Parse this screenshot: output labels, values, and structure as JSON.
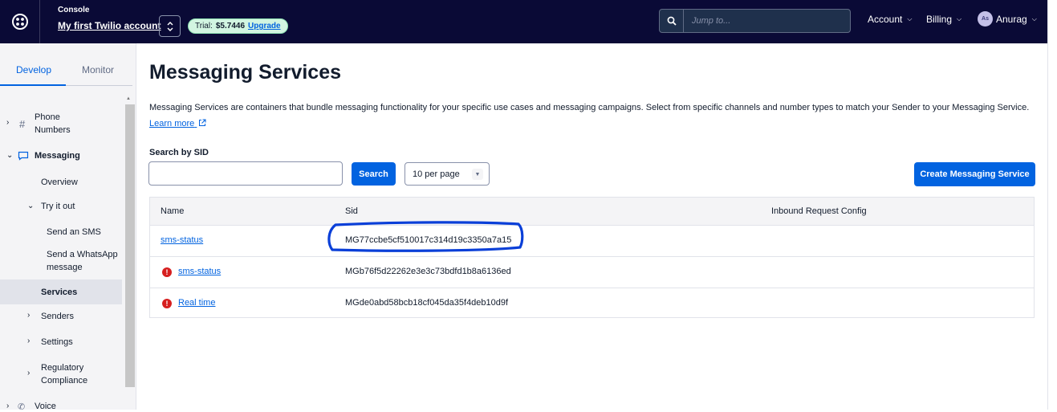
{
  "topbar": {
    "console_label": "Console",
    "account_name": "My first Twilio account",
    "trial_prefix": "Trial:",
    "trial_amount": "$5.7446",
    "upgrade_label": "Upgrade",
    "search_placeholder": "Jump to...",
    "account_menu": "Account",
    "billing_menu": "Billing",
    "user_initials": "As",
    "user_name": "Anurag"
  },
  "sidebar": {
    "tabs": [
      "Develop",
      "Monitor"
    ],
    "active_tab": "Develop",
    "items": {
      "phone_numbers_line1": "Phone",
      "phone_numbers_line2": "Numbers",
      "messaging": "Messaging",
      "overview": "Overview",
      "try_it_out": "Try it out",
      "send_sms": "Send an SMS",
      "send_whatsapp_line1": "Send a WhatsApp",
      "send_whatsapp_line2": "message",
      "services": "Services",
      "senders": "Senders",
      "settings": "Settings",
      "regulatory_line1": "Regulatory",
      "regulatory_line2": "Compliance",
      "voice": "Voice"
    }
  },
  "main": {
    "title": "Messaging Services",
    "description": "Messaging Services are containers that bundle messaging functionality for your specific use cases and messaging campaigns. Select from specific channels and number types to match your Sender to your Messaging Service.",
    "learn_more": "Learn more",
    "search_label": "Search by SID",
    "search_value": "",
    "search_button": "Search",
    "per_page": "10 per page",
    "create_button": "Create Messaging Service",
    "table": {
      "columns": [
        "Name",
        "Sid",
        "Inbound Request Config"
      ],
      "rows": [
        {
          "name": "sms-status",
          "sid": "MG77ccbe5cf510017c314d19c3350a7a15",
          "inbound": "",
          "error": false
        },
        {
          "name": "sms-status",
          "sid": "MGb76f5d22262e3e3c73bdfd1b8a6136ed",
          "inbound": "",
          "error": true
        },
        {
          "name": "Real time",
          "sid": "MGde0abd58bcb18cf045da35f4deb10d9f",
          "inbound": "",
          "error": true
        }
      ]
    }
  },
  "colors": {
    "topbar_bg": "#0a0a36",
    "primary_blue": "#0263e0",
    "error_red": "#d61f1f",
    "annotation_blue": "#0a3fd8",
    "trial_pill_bg": "#d2f5e1"
  },
  "icons": {
    "logo": "twilio-logo-icon",
    "search": "search-icon",
    "switcher": "chevron-up-down-icon",
    "error": "error-icon",
    "external_link": "external-link-icon"
  }
}
